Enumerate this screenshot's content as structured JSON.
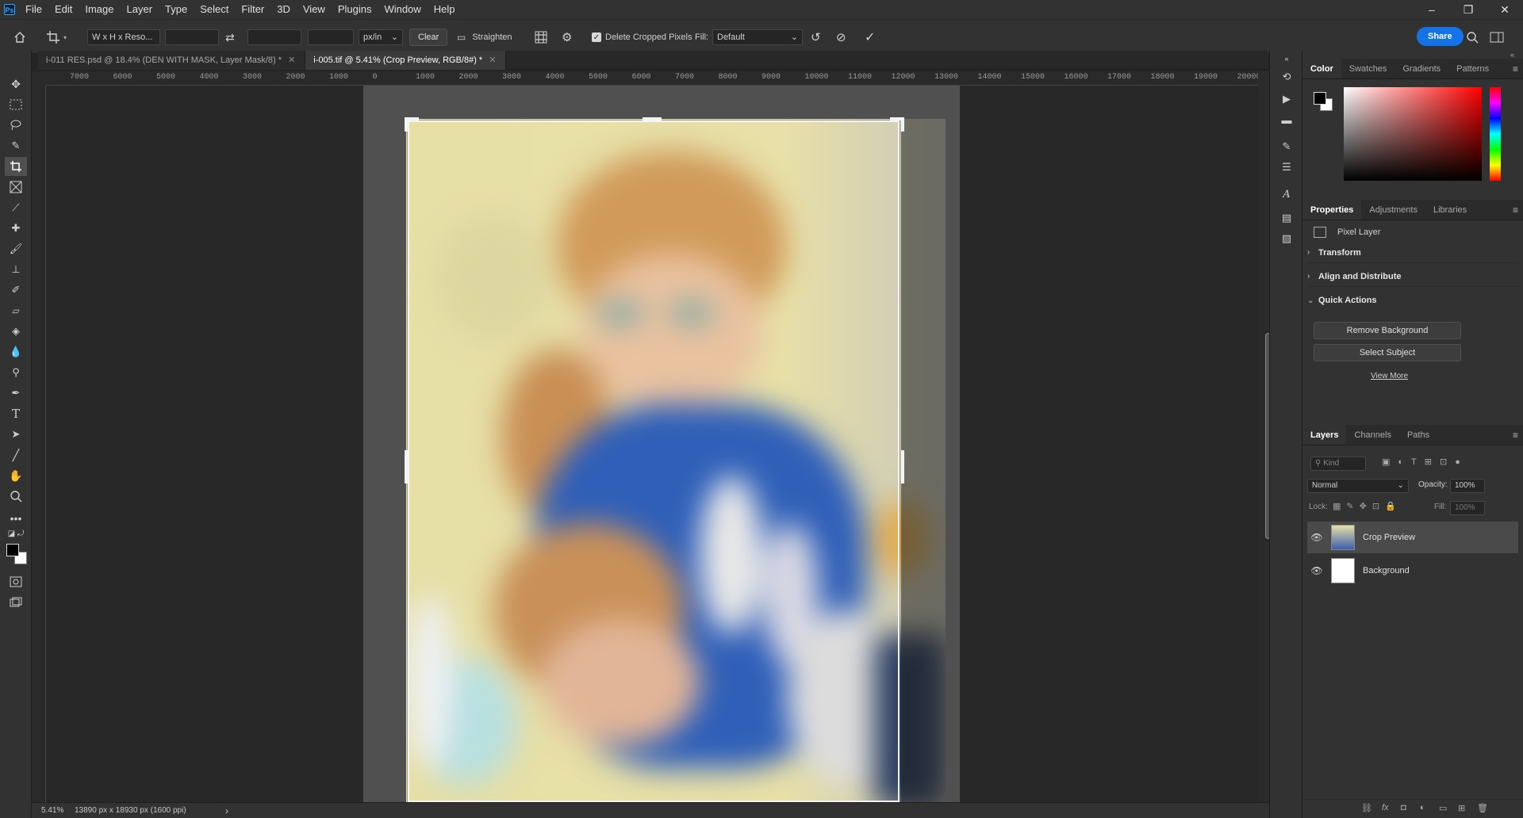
{
  "app": {
    "logo": "Ps"
  },
  "menu": [
    "File",
    "Edit",
    "Image",
    "Layer",
    "Type",
    "Select",
    "Filter",
    "3D",
    "View",
    "Plugins",
    "Window",
    "Help"
  ],
  "window_controls": {
    "minimize": "–",
    "restore": "❐",
    "close": "✕"
  },
  "options": {
    "ratio_preset": "W x H x Reso...",
    "width_value": "",
    "height_value": "",
    "resolution_value": "",
    "resolution_unit": "px/in",
    "clear_label": "Clear",
    "straighten_label": "Straighten",
    "delete_cropped_label": "Delete Cropped Pixels",
    "delete_cropped_checked": true,
    "fill_label": "Fill:",
    "fill_value": "Default",
    "share_label": "Share"
  },
  "doc_tabs": [
    {
      "label": "i-011 RES.psd @ 18.4% (DEN WITH MASK, Layer Mask/8) *",
      "active": false
    },
    {
      "label": "i-005.tif @ 5.41% (Crop Preview, RGB/8#) *",
      "active": true
    }
  ],
  "ruler_top": [
    "7000",
    "6000",
    "5000",
    "4000",
    "3000",
    "2000",
    "1000",
    "0",
    "1000",
    "2000",
    "3000",
    "4000",
    "5000",
    "6000",
    "7000",
    "8000",
    "9000",
    "10000",
    "11000",
    "12000",
    "13000",
    "14000",
    "15000",
    "16000",
    "17000",
    "18000",
    "19000",
    "20000"
  ],
  "status": {
    "zoom": "5.41%",
    "doc_info": "13890 px x 18930 px (1600 ppi)",
    "arrow": "›"
  },
  "color_panel": {
    "tabs": [
      "Color",
      "Swatches",
      "Gradients",
      "Patterns"
    ],
    "active": "Color",
    "hue_color": "#ff0000"
  },
  "properties_panel": {
    "tabs": [
      "Properties",
      "Adjustments",
      "Libraries"
    ],
    "active": "Properties",
    "layer_type": "Pixel Layer",
    "sections": [
      "Transform",
      "Align and Distribute",
      "Quick Actions"
    ],
    "buttons": [
      "Remove Background",
      "Select Subject"
    ],
    "view_more": "View More"
  },
  "layers_panel": {
    "tabs": [
      "Layers",
      "Channels",
      "Paths"
    ],
    "active": "Layers",
    "kind_placeholder": "Kind",
    "blend_mode": "Normal",
    "opacity_label": "Opacity:",
    "opacity_value": "100%",
    "lock_label": "Lock:",
    "fill_label": "Fill:",
    "fill_value": "100%",
    "layers": [
      {
        "name": "Crop Preview",
        "selected": true
      },
      {
        "name": "Background",
        "selected": false
      }
    ]
  },
  "colors": {
    "accent": "#1473e6",
    "background": "#252525",
    "panel": "#323232",
    "image_bg": "#e6dfa6"
  }
}
